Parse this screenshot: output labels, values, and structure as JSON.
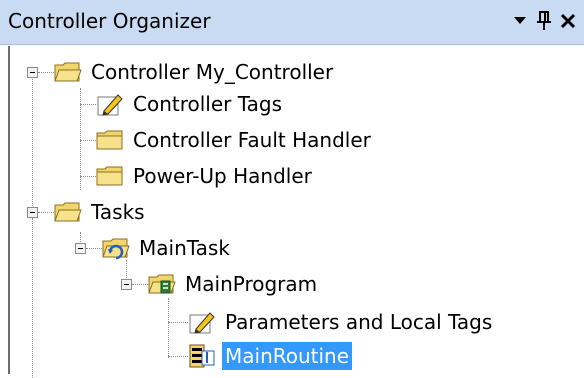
{
  "panel": {
    "title": "Controller Organizer",
    "controls": {
      "dropdown": "▾",
      "pin": "📌",
      "close": "✕"
    }
  },
  "tree": {
    "controller": "Controller My_Controller",
    "controller_tags": "Controller Tags",
    "fault_handler": "Controller Fault Handler",
    "powerup_handler": "Power-Up Handler",
    "tasks": "Tasks",
    "main_task": "MainTask",
    "main_program": "MainProgram",
    "param_tags": "Parameters and Local Tags",
    "main_routine": "MainRoutine"
  },
  "colors": {
    "title_bg": "#c9dbf2",
    "selection": "#3399ff",
    "folder": "#f2d66b"
  }
}
